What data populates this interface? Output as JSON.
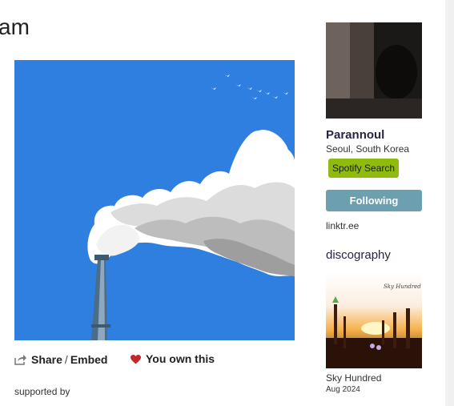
{
  "page": {
    "title_fragment": "am"
  },
  "album": {
    "art_alt": "Album artwork: smokestack with white smoke against blue sky"
  },
  "actions": {
    "share_label": "Share",
    "separator": "/",
    "embed_label": "Embed",
    "own_label": "You own this"
  },
  "supported_by": "supported by",
  "artist": {
    "name": "Parannoul",
    "location": "Seoul, South Korea",
    "spotify_label": "Spotify Search",
    "following_label": "Following",
    "link": "linktr.ee"
  },
  "discography": {
    "heading": "discography",
    "items": [
      {
        "title": "Sky Hundred",
        "date": "Aug 2024",
        "cover_text": "Sky Hundred"
      }
    ]
  },
  "colors": {
    "album_bg": "#2e7fe0",
    "following_button": "#6c9faf",
    "spotify_button": "#8fbb0f",
    "heart": "#c1272d"
  },
  "icons": {
    "share": "share-icon",
    "heart": "heart-icon"
  }
}
